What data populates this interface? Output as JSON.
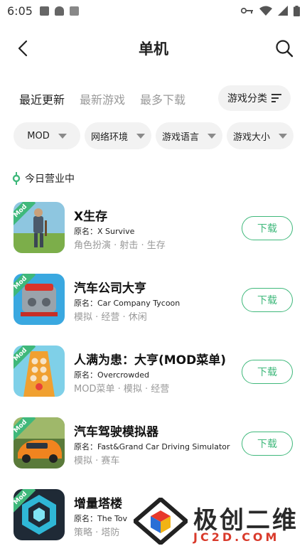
{
  "status_bar": {
    "time": "6:05"
  },
  "header": {
    "title": "单机"
  },
  "tabs": [
    {
      "label": "最近更新"
    },
    {
      "label": "最新游戏"
    },
    {
      "label": "最多下载"
    }
  ],
  "category_button": {
    "label": "游戏分类"
  },
  "filters": [
    {
      "label": "MOD"
    },
    {
      "label": "网络环境"
    },
    {
      "label": "游戏语言"
    },
    {
      "label": "游戏大小"
    }
  ],
  "section": {
    "title": "今日营业中"
  },
  "apps": [
    {
      "name": "X生存",
      "original": "原名：X Survive",
      "tags": "角色扮演 · 射击 · 生存",
      "badge": "Mod",
      "download_label": "下载"
    },
    {
      "name": "汽车公司大亨",
      "original": "原名：Car Company Tycoon",
      "tags": "模拟 · 经营 · 休闲",
      "badge": "Mod",
      "download_label": "下载"
    },
    {
      "name": "人满为患：大亨(MOD菜单)",
      "original": "原名：Overcrowded",
      "tags": "MOD菜单 · 模拟 · 经营",
      "badge": "Mod",
      "download_label": "下载"
    },
    {
      "name": "汽车驾驶模拟器",
      "original": "原名：Fast&Grand Car Driving Simulator",
      "tags": "模拟 · 赛车",
      "badge": "Mod",
      "download_label": "下载"
    },
    {
      "name": "增量塔楼",
      "original": "原名：The Tov",
      "tags": "策略 · 塔防",
      "badge": "Mod",
      "download_label": "下载"
    }
  ],
  "watermark": {
    "title": "极创二维",
    "subtitle": "JC2D.COM"
  },
  "colors": {
    "accent": "#3fb87b",
    "tab_highlight": "#c8ecd2",
    "chip_bg": "#f2f2f2",
    "watermark_red": "#d93a2b"
  }
}
